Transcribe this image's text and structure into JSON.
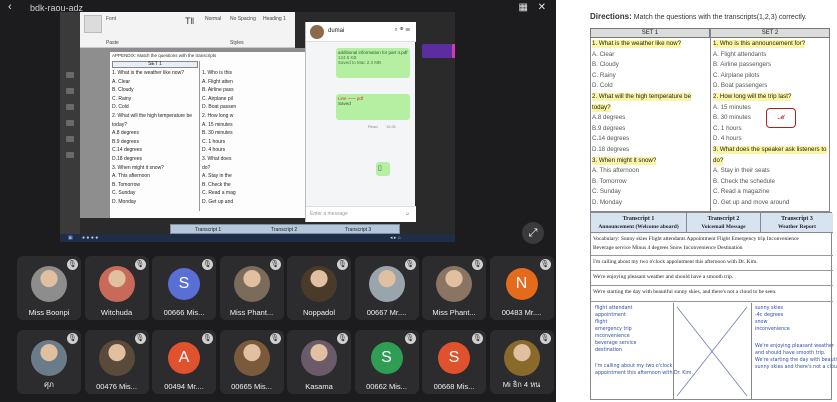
{
  "window": {
    "title": "bdk-raou-adz",
    "back_icon": "chevron-left-icon"
  },
  "shared_screen": {
    "ribbon": {
      "tabs": [
        "Font",
        "Paste",
        "Styles"
      ],
      "style_labels": [
        "Normal",
        "No Spacing",
        "Heading 1"
      ]
    },
    "doc": {
      "header": "APPENDIX: Match the questions with the transcripts",
      "set1": "SET 1",
      "left_lines": [
        "1. What is the weather like now?",
        "A. Clear",
        "B. Cloudy",
        "C. Rainy",
        "D. Cold",
        "2. What will the high temperature be",
        "today?",
        "A.8 degrees",
        "B.9 degrees",
        "C.14 degrees",
        "D.18 degrees",
        "3. When might it snow?",
        "A. This afternoon",
        "B. Tomorrow",
        "C. Sunday",
        "D. Monday"
      ],
      "right_lines": [
        "1. Who is this",
        "A. Flight atten",
        "B. Airline pass",
        "C. Airplane pil",
        "D. Boat passen",
        "2. How long w",
        "A. 15 minutes",
        "B. 30 minutes",
        "C. 1 hours",
        "D. 4 hours",
        "3. What does",
        "do?",
        "A. Stay in the",
        "B. Check the",
        "C. Read a mag",
        "D. Get up and"
      ]
    },
    "transcripts": [
      "Transcript 1",
      "Transcript 2",
      "Transcript 3"
    ],
    "chat": {
      "name": "dumai",
      "file1": "additional information for part 4.pdf",
      "file1_size": "124.5 KB",
      "file1_meta": "Saved to Mac 2.3 MB",
      "file2": "Line ~~~ pdf",
      "file2_meta": "Saved",
      "sent_time": "15:31",
      "read_label": "Read",
      "input_placeholder": "Enter a message"
    }
  },
  "participants": [
    {
      "name": "Miss Boonpi",
      "type": "photo",
      "color": "#8d8d8d"
    },
    {
      "name": "Witchuda",
      "type": "photo",
      "color": "#c86a5a"
    },
    {
      "name": "00666 Mis...",
      "type": "initial",
      "initial": "S",
      "color": "#5a6fd6"
    },
    {
      "name": "Miss Phant...",
      "type": "photo",
      "color": "#7a6b5a"
    },
    {
      "name": "Noppadol",
      "type": "photo",
      "color": "#4a3a2a"
    },
    {
      "name": "00667 Mr....",
      "type": "photo",
      "color": "#9aa4ad"
    },
    {
      "name": "Miss Phant...",
      "type": "photo",
      "color": "#8a7565"
    },
    {
      "name": "00483 Mr....",
      "type": "initial",
      "initial": "N",
      "color": "#e46a1c"
    },
    {
      "name": "ศุภ",
      "type": "photo",
      "color": "#6a7c8a"
    },
    {
      "name": "00476 Mis...",
      "type": "photo",
      "color": "#5a4a3a"
    },
    {
      "name": "00494 Mr....",
      "type": "initial",
      "initial": "A",
      "color": "#e0512d"
    },
    {
      "name": "00665 Mis...",
      "type": "photo",
      "color": "#7a5a3a"
    },
    {
      "name": "Kasama",
      "type": "photo",
      "color": "#6a5a6a"
    },
    {
      "name": "00662 Mis...",
      "type": "initial",
      "initial": "S",
      "color": "#2f9d53"
    },
    {
      "name": "00668 Mis...",
      "type": "initial",
      "initial": "S",
      "color": "#e0512d"
    },
    {
      "name": "Mi  ธิก 4 หน",
      "type": "photo",
      "color": "#8a6a2a"
    }
  ],
  "expand_icon": "expand-icon",
  "worksheet": {
    "directions_label": "Directions:",
    "directions_text": "Match the questions with the transcripts(1,2,3) correctly.",
    "set1": "SET 1",
    "set2": "SET 2",
    "left": [
      {
        "t": "1. What is the weather like now?",
        "hl": true
      },
      {
        "t": "A. Clear"
      },
      {
        "t": "B. Cloudy"
      },
      {
        "t": "C. Rainy"
      },
      {
        "t": "D. Cold"
      },
      {
        "t": "2. What will the high temperature be",
        "hl": true
      },
      {
        "t": "today?",
        "hl": true
      },
      {
        "t": "A.8 degrees"
      },
      {
        "t": "B.9 degrees"
      },
      {
        "t": "C.14 degrees"
      },
      {
        "t": "D.18 degrees"
      },
      {
        "t": "3. When might it snow?",
        "hl": true
      },
      {
        "t": "A. This afternoon"
      },
      {
        "t": "B. Tomorrow"
      },
      {
        "t": "C. Sunday"
      },
      {
        "t": "D. Monday"
      }
    ],
    "right": [
      {
        "t": "1. Who is this announcement for?",
        "hl": true
      },
      {
        "t": "A. Flight attendants"
      },
      {
        "t": "B. Airline passengers"
      },
      {
        "t": "C. Airplane pilots"
      },
      {
        "t": "D. Boat passengers"
      },
      {
        "t": "2. How long will the trip last?",
        "hl": true
      },
      {
        "t": "A. 15 minutes"
      },
      {
        "t": "B. 30 minutes"
      },
      {
        "t": "C. 1 hours"
      },
      {
        "t": "D. 4 hours"
      },
      {
        "t": "3. What does the speaker ask listeners to",
        "hl": true
      },
      {
        "t": "do?",
        "hl": true
      },
      {
        "t": "A. Stay in their seats"
      },
      {
        "t": "B. Check the schedule"
      },
      {
        "t": "C. Read a magazine"
      },
      {
        "t": "D. Get up and move around"
      }
    ]
  },
  "transcript_table": {
    "headers": [
      {
        "title": "Transcript 1",
        "sub": "Announcement (Welcome aboard)"
      },
      {
        "title": "Transcript 2",
        "sub": "Voicemail Message"
      },
      {
        "title": "Transcript 3",
        "sub": "Weather Report"
      }
    ],
    "vocab": "Vocabulary: Sunny skies   Flight attendants   Appointment   Flight   Emergency trip   Inconvenience",
    "vocab2": "Beverage service   Minus 4 degrees   Snow   Inconvenience   Destination",
    "lines": [
      "I'm calling about my two o'clock appointment this afternoon with Dr. Kim.",
      "We're enjoying pleasant weather and should have a smooth trip.",
      "We're starting the day with beautiful sunny skies, and there's not a cloud to be seen."
    ],
    "hand1": [
      "flight attendant",
      "appointment",
      "flight",
      "emergency trip",
      "inconvenience",
      "beverage service",
      "destination"
    ],
    "hand2": [
      "sunny skies",
      "-4c degrees",
      "snow",
      "inconvenience"
    ],
    "hand3": [
      "I'm calling about my two o'clock",
      "appointment this afternoon with Dr. Kim."
    ],
    "hand4": [
      "We're enjoying pleasant weather",
      "and should have smooth trip.",
      "We're starting the day with beautiful",
      "sunny skies and there's not a cloud to be seen."
    ]
  }
}
